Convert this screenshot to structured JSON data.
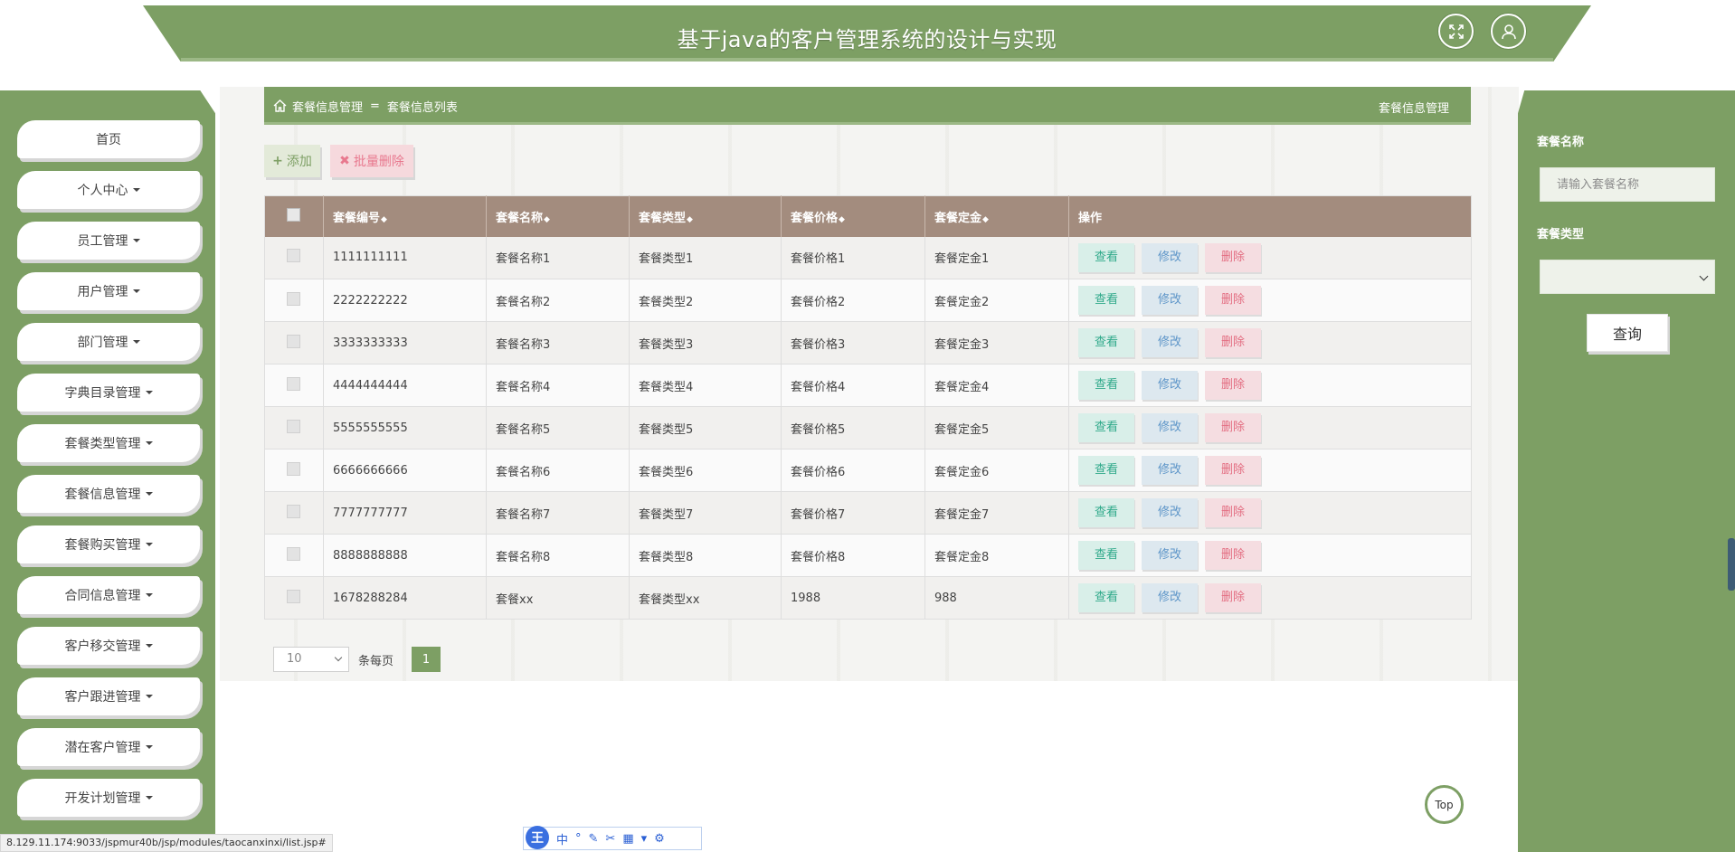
{
  "header": {
    "title": "基于java的客户管理系统的设计与实现",
    "fullscreen_icon": "expand-icon",
    "user_icon": "user-icon"
  },
  "sidebar": {
    "items": [
      {
        "label": "首页",
        "has_caret": false
      },
      {
        "label": "个人中心",
        "has_caret": true
      },
      {
        "label": "员工管理",
        "has_caret": true
      },
      {
        "label": "用户管理",
        "has_caret": true
      },
      {
        "label": "部门管理",
        "has_caret": true
      },
      {
        "label": "字典目录管理",
        "has_caret": true
      },
      {
        "label": "套餐类型管理",
        "has_caret": true
      },
      {
        "label": "套餐信息管理",
        "has_caret": true
      },
      {
        "label": "套餐购买管理",
        "has_caret": true
      },
      {
        "label": "合同信息管理",
        "has_caret": true
      },
      {
        "label": "客户移交管理",
        "has_caret": true
      },
      {
        "label": "客户跟进管理",
        "has_caret": true
      },
      {
        "label": "潜在客户管理",
        "has_caret": true
      },
      {
        "label": "开发计划管理",
        "has_caret": true
      }
    ]
  },
  "breadcrumb": {
    "home_icon": "home-icon",
    "level1": "套餐信息管理",
    "separator": "=",
    "level2": "套餐信息列表",
    "right_title": "套餐信息管理"
  },
  "toolbar": {
    "add_label": "添加",
    "batch_delete_label": "批量删除"
  },
  "table": {
    "columns": [
      "套餐编号",
      "套餐名称",
      "套餐类型",
      "套餐价格",
      "套餐定金",
      "操作"
    ],
    "actions": {
      "view": "查看",
      "edit": "修改",
      "delete": "删除"
    },
    "rows": [
      [
        "1111111111",
        "套餐名称1",
        "套餐类型1",
        "套餐价格1",
        "套餐定金1"
      ],
      [
        "2222222222",
        "套餐名称2",
        "套餐类型2",
        "套餐价格2",
        "套餐定金2"
      ],
      [
        "3333333333",
        "套餐名称3",
        "套餐类型3",
        "套餐价格3",
        "套餐定金3"
      ],
      [
        "4444444444",
        "套餐名称4",
        "套餐类型4",
        "套餐价格4",
        "套餐定金4"
      ],
      [
        "5555555555",
        "套餐名称5",
        "套餐类型5",
        "套餐价格5",
        "套餐定金5"
      ],
      [
        "6666666666",
        "套餐名称6",
        "套餐类型6",
        "套餐价格6",
        "套餐定金6"
      ],
      [
        "7777777777",
        "套餐名称7",
        "套餐类型7",
        "套餐价格7",
        "套餐定金7"
      ],
      [
        "8888888888",
        "套餐名称8",
        "套餐类型8",
        "套餐价格8",
        "套餐定金8"
      ],
      [
        "1678288284",
        "套餐xx",
        "套餐类型xx",
        "1988",
        "988"
      ]
    ]
  },
  "pagination": {
    "page_size": "10",
    "per_page_label": "条每页",
    "current_page": "1"
  },
  "search": {
    "name_label": "套餐名称",
    "name_placeholder": "请输入套餐名称",
    "type_label": "套餐类型",
    "type_value": "",
    "query_button": "查询"
  },
  "floating": {
    "top_label": "Top"
  },
  "statusbar": {
    "url": "8.129.11.174:9033/jspmur40b/jsp/modules/taocanxinxi/list.jsp#"
  },
  "ime": {
    "logo": "王",
    "mode": "中"
  },
  "colors": {
    "primary_green": "#7d9f64",
    "table_header": "#a38c7e",
    "view": "#2fa98a",
    "edit": "#5d95c8",
    "delete": "#e36c80"
  }
}
